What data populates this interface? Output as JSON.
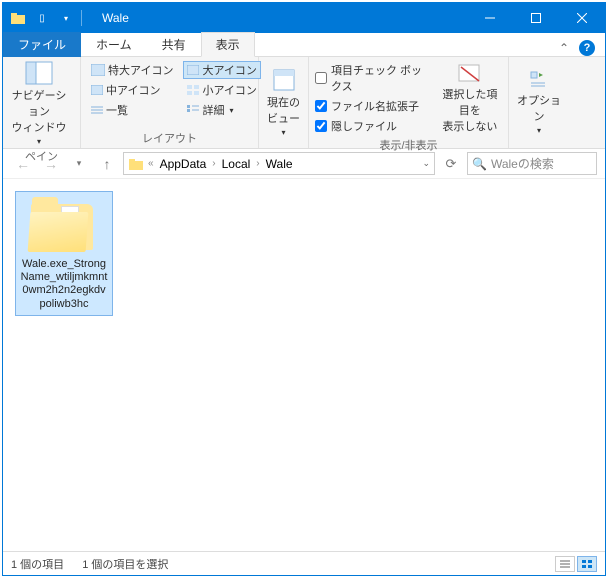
{
  "title": "Wale",
  "tabs": {
    "file": "ファイル",
    "home": "ホーム",
    "share": "共有",
    "view": "表示"
  },
  "ribbon": {
    "panes": {
      "nav": "ナビゲーション\nウィンドウ",
      "group_label": "ペイン"
    },
    "layout": {
      "extra_large": "特大アイコン",
      "large": "大アイコン",
      "medium": "中アイコン",
      "small": "小アイコン",
      "list": "一覧",
      "details": "詳細",
      "group_label": "レイアウト"
    },
    "current_view": {
      "label": "現在の\nビュー"
    },
    "showhide": {
      "checkboxes": "項目チェック ボックス",
      "extensions": "ファイル名拡張子",
      "hidden": "隠しファイル",
      "hide_selected": "選択した項目を\n表示しない",
      "group_label": "表示/非表示"
    },
    "options": "オプション"
  },
  "breadcrumb": {
    "drive_icon": "⯈",
    "items": [
      "AppData",
      "Local",
      "Wale"
    ]
  },
  "search": {
    "placeholder": "Waleの検索"
  },
  "content": {
    "items": [
      {
        "name": "Wale.exe_StrongName_wtiljmkmnt0wm2h2n2egkdvpoliwb3hc"
      }
    ]
  },
  "status": {
    "count": "1 個の項目",
    "selected": "1 個の項目を選択"
  }
}
